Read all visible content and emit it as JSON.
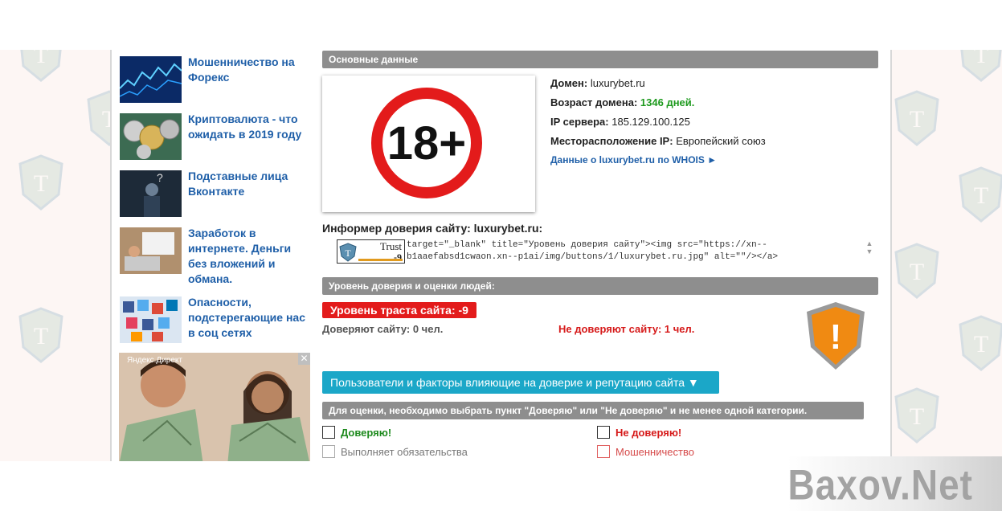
{
  "sidebar": {
    "news": [
      {
        "title": "Мошенничество на Форекс"
      },
      {
        "title": "Криптовалюта - что ожидать в 2019 году"
      },
      {
        "title": "Подставные лица Вконтакте"
      },
      {
        "title": "Заработок в интернете. Деньги без вложений и обмана."
      },
      {
        "title": "Опасности, подстерегающие нас в соц сетях"
      }
    ],
    "ad": {
      "label": "Яндекс.Директ",
      "close": "✕"
    }
  },
  "main": {
    "basic_section_title": "Основные данные",
    "logo_text": "18+",
    "domain_label": "Домен:",
    "domain_value": "luxurybet.ru",
    "age_label": "Возраст домена:",
    "age_value": "1346 дней.",
    "ip_label": "IP сервера:",
    "ip_value": "185.129.100.125",
    "location_label": "Месторасположение IP:",
    "location_value": "Европейский союз",
    "whois_link": "Данные о luxurybet.ru по WHOIS ►",
    "informer_title": "Информер доверия сайту: luxurybet.ru:",
    "badge_trust": "Trust",
    "badge_score": "-9",
    "informer_code": "target=\"_blank\" title=\"Уровень доверия сайту\"><img src=\"https://xn--b1aaefabsd1cwaon.xn--p1ai/img/buttons/1/luxurybet.ru.jpg\" alt=\"\"/></a>",
    "trust_section_title": "Уровень доверия и оценки людей:",
    "trust_level": "Уровень траста сайта: -9",
    "trust_yes": "Доверяют сайту: 0 чел.",
    "trust_no": "Не доверяют сайту: 1 чел.",
    "shield_symbol": "!",
    "factors_button": "Пользователи и факторы влияющие на доверие и репутацию сайта ▼",
    "rating_note": "Для оценки, необходимо выбрать пункт \"Доверяю\" или \"Не доверяю\" и не менее одной категории.",
    "trust_option": "Доверяю!",
    "distrust_option": "Не доверяю!",
    "trust_category_1": "Выполняет обязательства",
    "distrust_category_1": "Мошенничество"
  },
  "brand": {
    "text": "Baxov.Net"
  },
  "colors": {
    "link_blue": "#1f5fa8",
    "section_grey": "#8e8e8e",
    "danger_red": "#e31b1b",
    "accent_cyan": "#1ba7c8",
    "positive_green": "#1e9a1e",
    "shield_orange": "#f08a12"
  },
  "icons": {
    "age_restriction": "18-plus-icon",
    "trust_badge": "trust-badge-icon",
    "warning_shield": "warning-shield-icon",
    "watermark": "t-shield-watermark-icon"
  }
}
